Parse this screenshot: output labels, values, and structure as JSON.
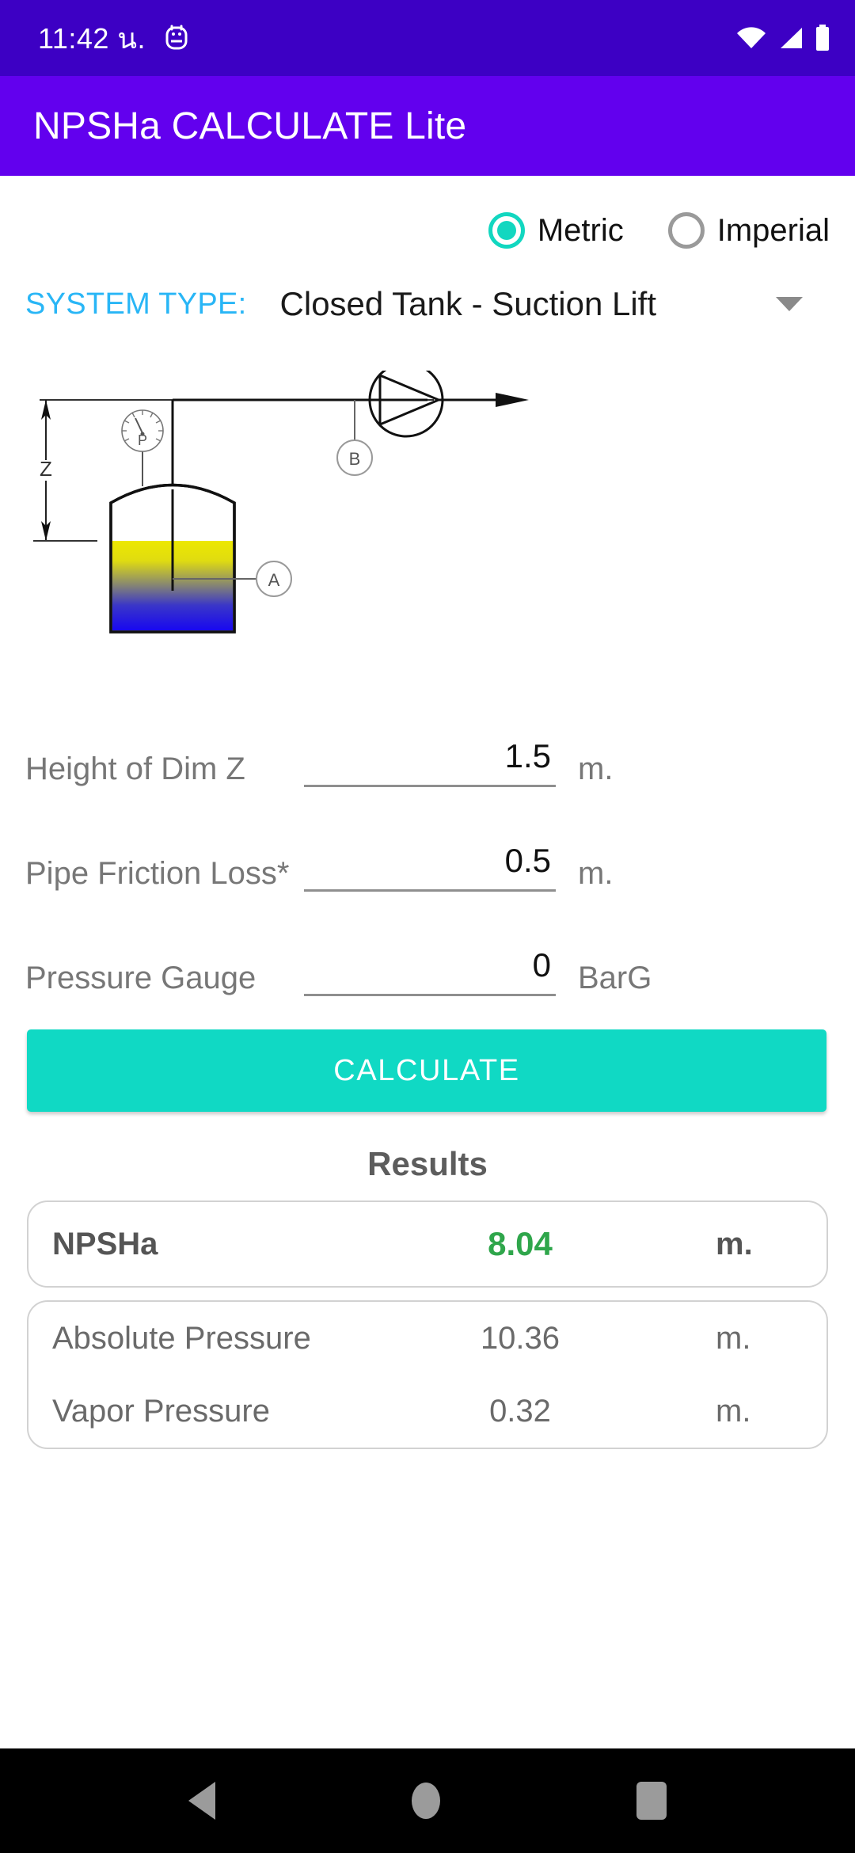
{
  "status_bar": {
    "time": "11:42 น.",
    "icons": [
      "sms-icon",
      "wifi-icon",
      "signal-icon",
      "battery-icon"
    ]
  },
  "app_bar": {
    "title": "NPSHa CALCULATE Lite"
  },
  "units": {
    "options": [
      {
        "label": "Metric",
        "selected": true
      },
      {
        "label": "Imperial",
        "selected": false
      }
    ],
    "selected_color": "#12D7C0",
    "unselected_color": "#9a9a9a"
  },
  "system_type": {
    "label": "SYSTEM TYPE:",
    "value": "Closed Tank - Suction Lift",
    "label_color": "#29B6F6",
    "caret": "chevron-down-icon"
  },
  "diagram": {
    "name": "closed-tank-suction-lift-diagram",
    "dimension_label": "Z",
    "gauge_label": "P",
    "point_a_label": "A",
    "point_b_label": "B",
    "liquid_top_color": "#EDE800",
    "liquid_bottom_color": "#1808F0"
  },
  "inputs": [
    {
      "label": "Height of Dim Z",
      "value": "1.5",
      "unit": "m."
    },
    {
      "label": "Pipe Friction Loss*",
      "value": "0.5",
      "unit": "m."
    },
    {
      "label": "Pressure Gauge",
      "value": "0",
      "unit": "BarG"
    }
  ],
  "calculate_button": {
    "label": "CALCULATE",
    "color": "#10D9C4"
  },
  "results": {
    "title": "Results",
    "primary": {
      "name": "NPSHa",
      "value": "8.04",
      "unit": "m.",
      "value_color": "#2FA64B"
    },
    "details": [
      {
        "name": "Absolute Pressure",
        "value": "10.36",
        "unit": "m."
      },
      {
        "name": "Vapor Pressure",
        "value": "0.32",
        "unit": "m."
      }
    ]
  },
  "nav_bar": {
    "back": "back-triangle-icon",
    "home": "home-circle-icon",
    "recents": "recents-square-icon"
  }
}
